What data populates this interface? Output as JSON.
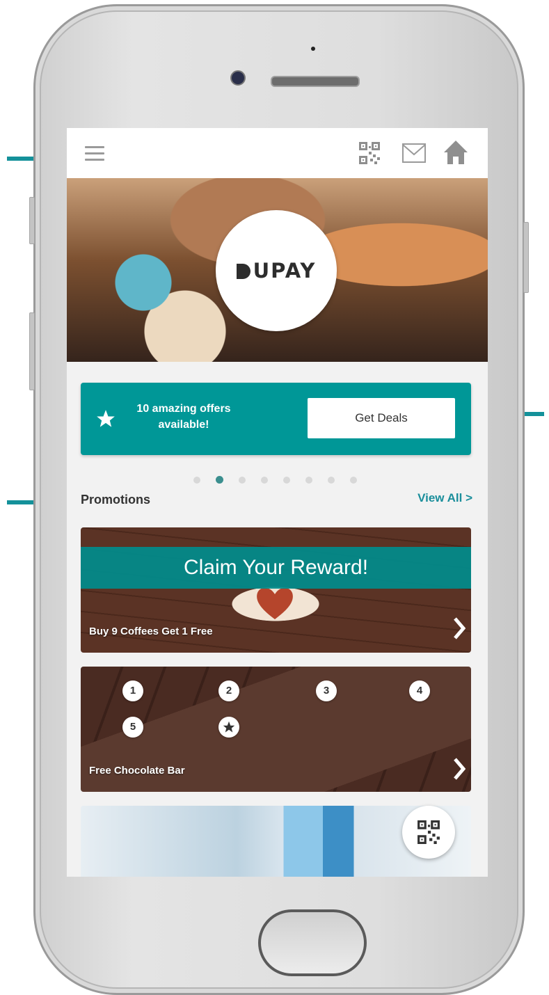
{
  "brand": {
    "logo_text": "UPAY"
  },
  "deals_banner": {
    "text_line1": "10 amazing offers",
    "text_line2": "available!",
    "button_label": "Get Deals"
  },
  "carousel": {
    "total_dots": 8,
    "active_index": 1
  },
  "promotions": {
    "title": "Promotions",
    "view_all": "View All >",
    "cards": [
      {
        "banner": "Claim Your Reward!",
        "label": "Buy 9 Coffees Get 1 Free"
      },
      {
        "label": "Free Chocolate Bar",
        "stamps": [
          "1",
          "2",
          "3",
          "4",
          "5"
        ],
        "stamps_collected": 5
      }
    ]
  },
  "colors": {
    "accent": "#009797",
    "link": "#1a8e9b",
    "annotation_arrow": "#14919a"
  }
}
